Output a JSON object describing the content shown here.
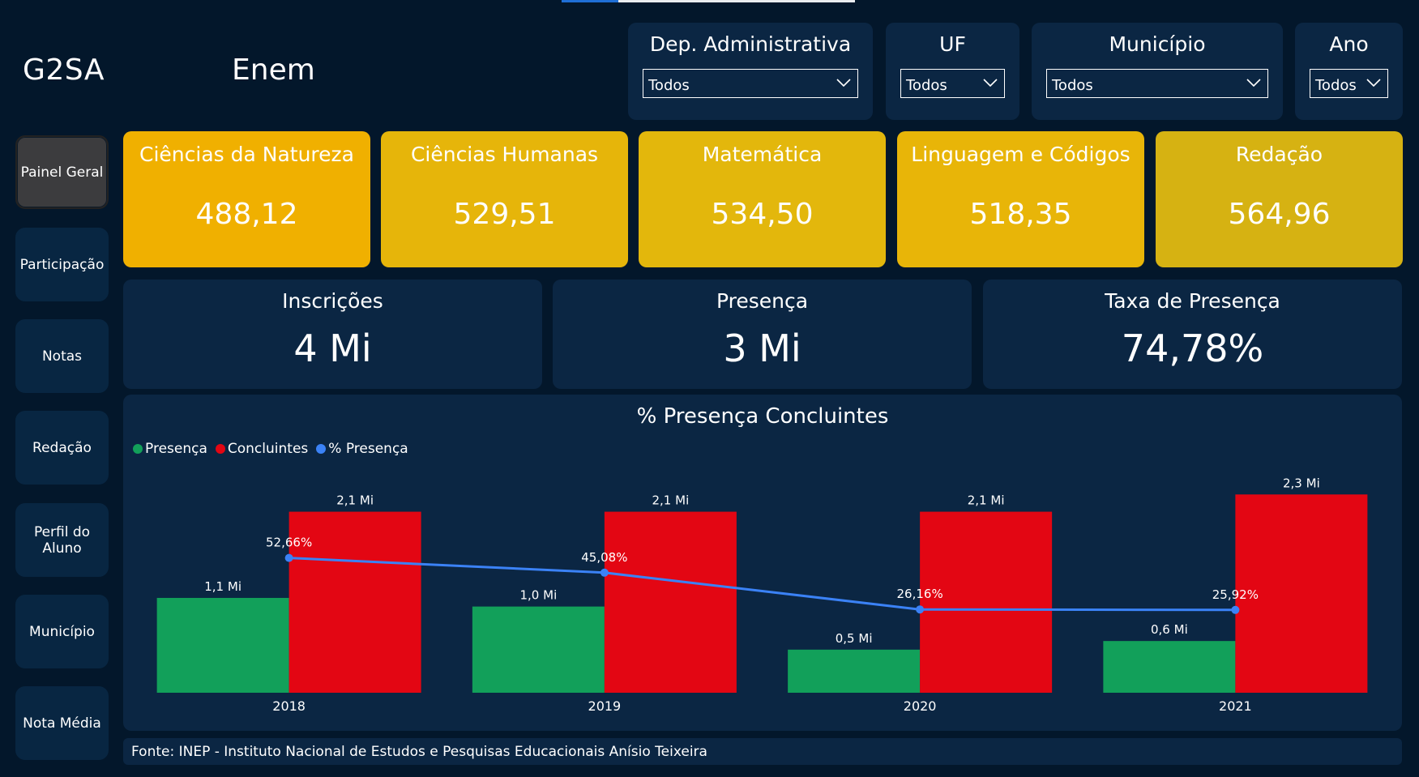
{
  "app": {
    "logo": "G2SA",
    "page_title": "Enem"
  },
  "filters": [
    {
      "label": "Dep. Administrativa",
      "value": "Todos"
    },
    {
      "label": "UF",
      "value": "Todos"
    },
    {
      "label": "Município",
      "value": "Todos"
    },
    {
      "label": "Ano",
      "value": "Todos"
    }
  ],
  "nav": [
    {
      "label": "Painel Geral",
      "active": true
    },
    {
      "label": "Participação"
    },
    {
      "label": "Notas"
    },
    {
      "label": "Redação"
    },
    {
      "label": "Perfil do Aluno"
    },
    {
      "label": "Município"
    },
    {
      "label": "Nota Média"
    }
  ],
  "kpis": [
    {
      "label": "Ciências da Natureza",
      "value": "488,12",
      "color": "#f0b000"
    },
    {
      "label": "Ciências Humanas",
      "value": "529,51",
      "color": "#e6b50a"
    },
    {
      "label": "Matemática",
      "value": "534,50",
      "color": "#e3b70c"
    },
    {
      "label": "Linguagem e Códigos",
      "value": "518,35",
      "color": "#e8b508"
    },
    {
      "label": "Redação",
      "value": "564,96",
      "color": "#d6b212"
    }
  ],
  "stats": [
    {
      "label": "Inscrições",
      "value": "4 Mi"
    },
    {
      "label": "Presença",
      "value": "3 Mi"
    },
    {
      "label": "Taxa de Presença",
      "value": "74,78%"
    }
  ],
  "chart_data": {
    "type": "bar",
    "title": "% Presença Concluintes",
    "categories": [
      "2018",
      "2019",
      "2020",
      "2021"
    ],
    "series": [
      {
        "name": "Presença",
        "type": "bar",
        "color": "#12a05a",
        "values": [
          1.1,
          1.0,
          0.5,
          0.6
        ],
        "labels": [
          "1,1 Mi",
          "1,0 Mi",
          "0,5 Mi",
          "0,6 Mi"
        ]
      },
      {
        "name": "Concluintes",
        "type": "bar",
        "color": "#e30613",
        "values": [
          2.1,
          2.1,
          2.1,
          2.3
        ],
        "labels": [
          "2,1 Mi",
          "2,1 Mi",
          "2,1 Mi",
          "2,3 Mi"
        ]
      },
      {
        "name": "% Presença",
        "type": "line",
        "color": "#3b82f6",
        "values": [
          52.66,
          45.08,
          26.16,
          25.92
        ],
        "labels": [
          "52,66%",
          "45,08%",
          "26,16%",
          "25,92%"
        ]
      }
    ],
    "legend_position": "top-left",
    "grid": false
  },
  "footer": {
    "source": "Fonte: INEP - Instituto Nacional de Estudos e Pesquisas Educacionais Anísio Teixeira"
  }
}
